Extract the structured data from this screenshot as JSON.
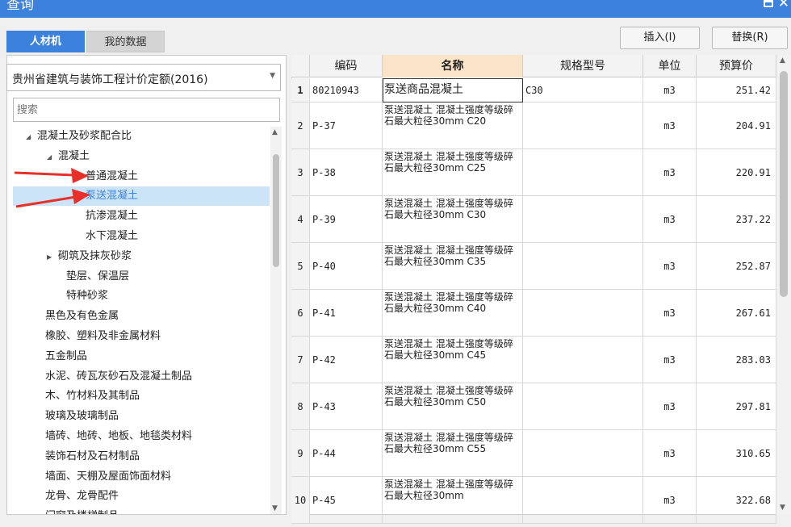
{
  "window": {
    "title": "查询"
  },
  "tabs": [
    {
      "label": "人材机"
    },
    {
      "label": "我的数据"
    }
  ],
  "toolbar": {
    "insert_label": "插入(I)",
    "replace_label": "替换(R)"
  },
  "library": {
    "selected": "贵州省建筑与装饰工程计价定额(2016)"
  },
  "search": {
    "placeholder": "搜索"
  },
  "tree": {
    "items": [
      {
        "label": "混凝土及砂浆配合比",
        "arrow": "◢"
      },
      {
        "label": "混凝土",
        "arrow": "◢"
      },
      {
        "label": "普通混凝土",
        "arrow": ""
      },
      {
        "label": "泵送混凝土",
        "arrow": ""
      },
      {
        "label": "抗渗混凝土",
        "arrow": ""
      },
      {
        "label": "水下混凝土",
        "arrow": ""
      },
      {
        "label": "砌筑及抹灰砂浆",
        "arrow": "▶"
      },
      {
        "label": "垫层、保温层",
        "arrow": ""
      },
      {
        "label": "特种砂浆",
        "arrow": ""
      },
      {
        "label": "黑色及有色金属",
        "arrow": ""
      },
      {
        "label": "橡胶、塑料及非金属材料",
        "arrow": ""
      },
      {
        "label": "五金制品",
        "arrow": ""
      },
      {
        "label": "水泥、砖瓦灰砂石及混凝土制品",
        "arrow": ""
      },
      {
        "label": "木、竹材料及其制品",
        "arrow": ""
      },
      {
        "label": "玻璃及玻璃制品",
        "arrow": ""
      },
      {
        "label": "墙砖、地砖、地板、地毯类材料",
        "arrow": ""
      },
      {
        "label": "装饰石材及石材制品",
        "arrow": ""
      },
      {
        "label": "墙面、天棚及屋面饰面材料",
        "arrow": ""
      },
      {
        "label": "龙骨、龙骨配件",
        "arrow": ""
      },
      {
        "label": "门窗及楼梯制品",
        "arrow": ""
      }
    ]
  },
  "table": {
    "headers": [
      "编码",
      "名称",
      "规格型号",
      "单位",
      "预算价"
    ],
    "rows": [
      {
        "idx": "1",
        "code": "80210943",
        "name": "泵送商品混凝土",
        "spec": "C30",
        "unit": "m3",
        "price": "251.42"
      },
      {
        "idx": "2",
        "code": "P-37",
        "name": "泵送混凝土 混凝土强度等级碎石最大粒径30mm C20",
        "spec": "",
        "unit": "m3",
        "price": "204.91"
      },
      {
        "idx": "3",
        "code": "P-38",
        "name": "泵送混凝土 混凝土强度等级碎石最大粒径30mm C25",
        "spec": "",
        "unit": "m3",
        "price": "220.91"
      },
      {
        "idx": "4",
        "code": "P-39",
        "name": "泵送混凝土 混凝土强度等级碎石最大粒径30mm C30",
        "spec": "",
        "unit": "m3",
        "price": "237.22"
      },
      {
        "idx": "5",
        "code": "P-40",
        "name": "泵送混凝土 混凝土强度等级碎石最大粒径30mm C35",
        "spec": "",
        "unit": "m3",
        "price": "252.87"
      },
      {
        "idx": "6",
        "code": "P-41",
        "name": "泵送混凝土 混凝土强度等级碎石最大粒径30mm C40",
        "spec": "",
        "unit": "m3",
        "price": "267.61"
      },
      {
        "idx": "7",
        "code": "P-42",
        "name": "泵送混凝土 混凝土强度等级碎石最大粒径30mm C45",
        "spec": "",
        "unit": "m3",
        "price": "283.03"
      },
      {
        "idx": "8",
        "code": "P-43",
        "name": "泵送混凝土 混凝土强度等级碎石最大粒径30mm C50",
        "spec": "",
        "unit": "m3",
        "price": "297.81"
      },
      {
        "idx": "9",
        "code": "P-44",
        "name": "泵送混凝土 混凝土强度等级碎石最大粒径30mm C55",
        "spec": "",
        "unit": "m3",
        "price": "310.65"
      },
      {
        "idx": "10",
        "code": "P-45",
        "name": "泵送混凝土 混凝土强度等级碎石最大粒径30mm",
        "spec": "",
        "unit": "m3",
        "price": "322.68"
      }
    ]
  },
  "colors": {
    "accent": "#3c82dc",
    "selection": "#cce4f7",
    "header_active": "#fbe3c8",
    "arrow": "#e8302a"
  }
}
